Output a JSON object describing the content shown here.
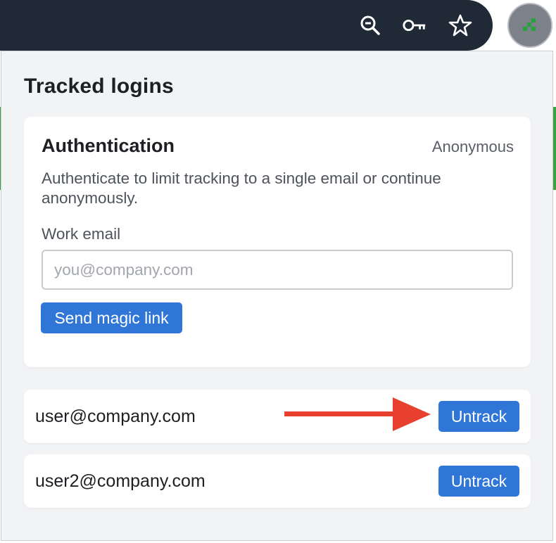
{
  "toolbar": {
    "icons": [
      "zoom-out-icon",
      "key-icon",
      "bookmark-star-icon",
      "extension-icon"
    ]
  },
  "popup": {
    "title": "Tracked logins",
    "authentication": {
      "title": "Authentication",
      "status": "Anonymous",
      "description": "Authenticate to limit tracking to a single email or continue anonymously.",
      "email_label": "Work email",
      "email_value": "",
      "email_placeholder": "you@company.com",
      "send_button_label": "Send magic link"
    },
    "logins": [
      {
        "email": "user@company.com",
        "action_label": "Untrack"
      },
      {
        "email": "user2@company.com",
        "action_label": "Untrack"
      }
    ]
  },
  "colors": {
    "accent": "#2f76d6",
    "annotation_arrow": "#e8402f",
    "toolbar_bg": "#202a37",
    "popup_bg": "#f2f3f5"
  }
}
